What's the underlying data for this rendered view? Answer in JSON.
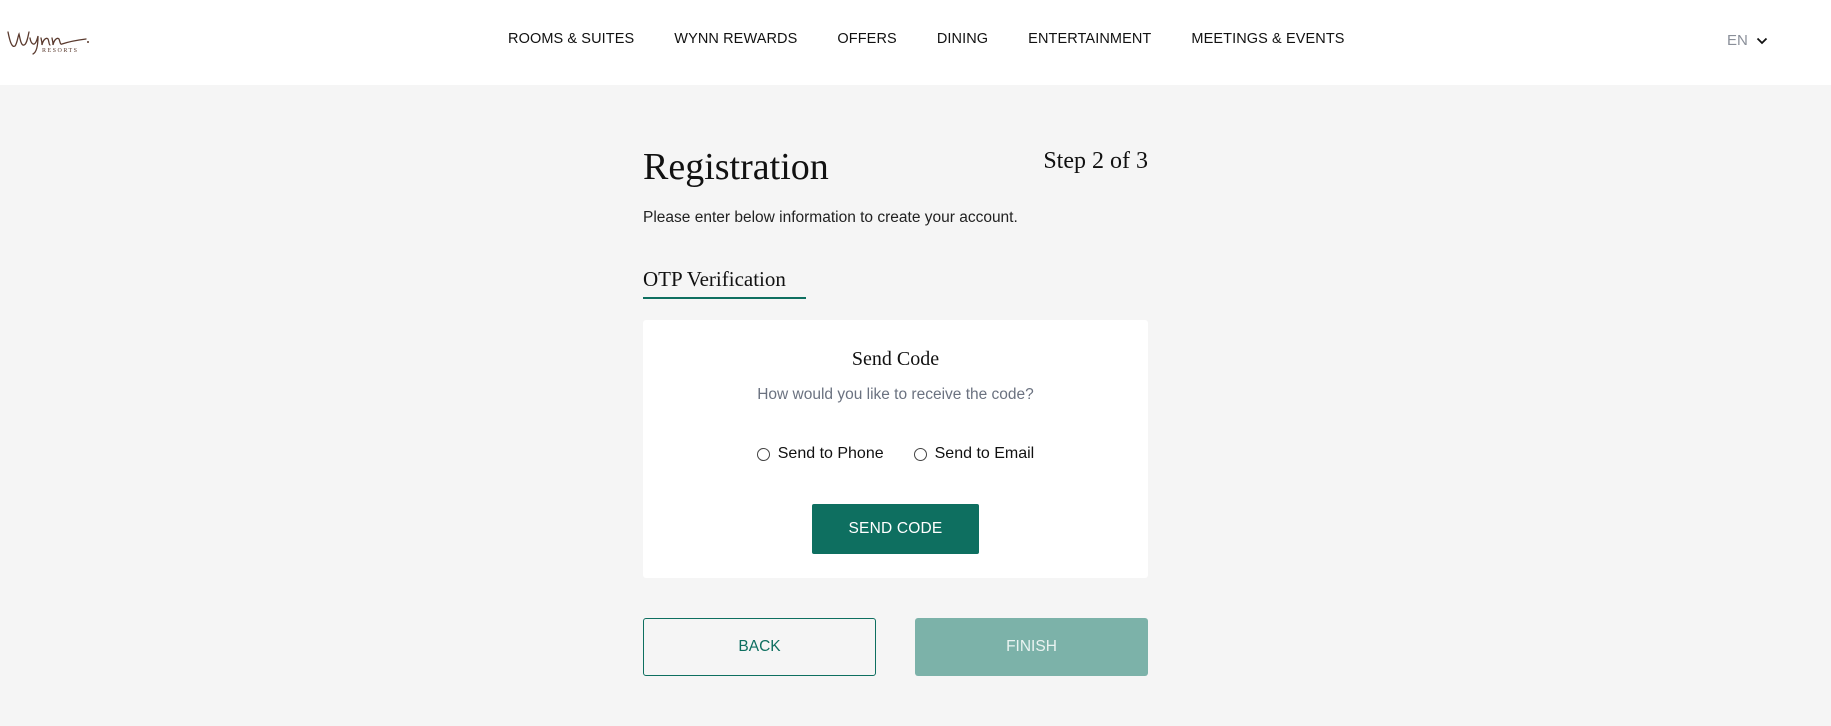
{
  "header": {
    "logo": {
      "script_text": "Wynn",
      "subtext": "RESORTS",
      "color": "#5a3a2e"
    },
    "nav": [
      {
        "label": "ROOMS & SUITES"
      },
      {
        "label": "WYNN REWARDS"
      },
      {
        "label": "OFFERS"
      },
      {
        "label": "DINING"
      },
      {
        "label": "ENTERTAINMENT"
      },
      {
        "label": "MEETINGS & EVENTS"
      }
    ],
    "language": {
      "selected": "EN",
      "icon": "chevron-down-icon"
    }
  },
  "page": {
    "title": "Registration",
    "step": "Step 2 of 3",
    "subtitle": "Please enter below information to create your account.",
    "section_tab": "OTP Verification"
  },
  "card": {
    "title": "Send Code",
    "question": "How would you like to receive the code?",
    "options": [
      {
        "label": "Send to Phone",
        "checked": false
      },
      {
        "label": "Send to Email",
        "checked": false
      }
    ],
    "send_button": "SEND CODE"
  },
  "actions": {
    "back": "BACK",
    "finish": "FINISH",
    "finish_disabled": true
  },
  "colors": {
    "accent": "#0e6f60",
    "accent_disabled": "#7cb2a9",
    "background": "#f5f5f5"
  }
}
